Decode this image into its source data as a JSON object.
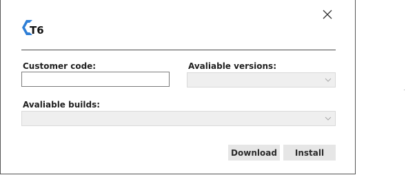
{
  "dialog": {
    "logo_text": "T6",
    "close_icon": "close-icon"
  },
  "form": {
    "customer_code_label": "Customer code:",
    "customer_code_value": "",
    "versions_label": "Avaliable versions:",
    "versions_selected": "",
    "builds_label": "Avaliable builds:",
    "builds_selected": ""
  },
  "actions": {
    "download_label": "Download",
    "install_label": "Install"
  },
  "colors": {
    "logo_blue": "#2f7fd6",
    "text_dark": "#1f1f1f",
    "disabled_field": "#efefef",
    "button_bg": "#e6e6e6"
  }
}
